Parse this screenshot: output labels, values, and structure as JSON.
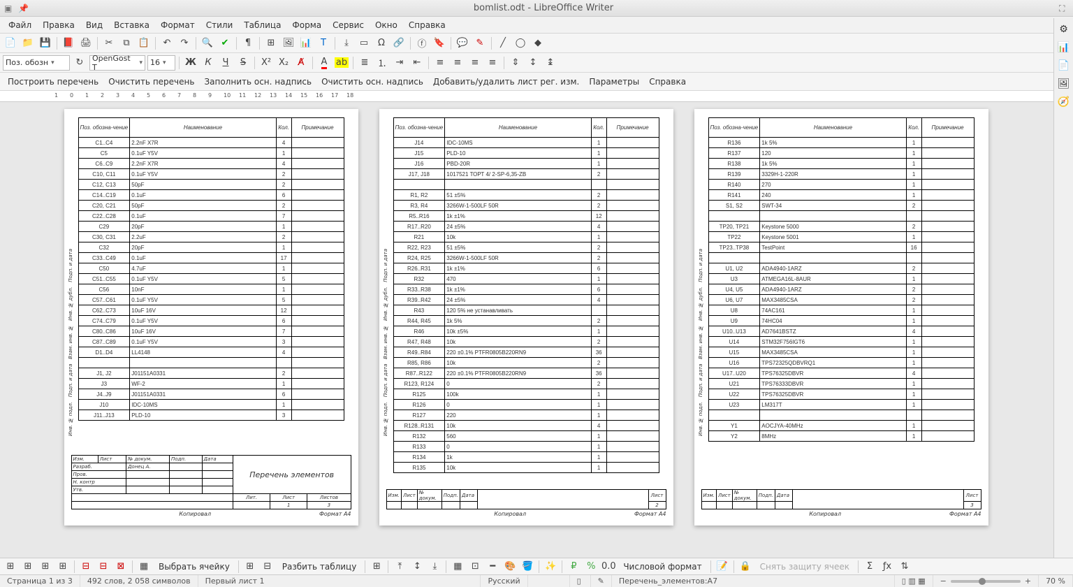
{
  "window": {
    "title": "bomlist.odt - LibreOffice Writer"
  },
  "menu": {
    "items": [
      "Файл",
      "Правка",
      "Вид",
      "Вставка",
      "Формат",
      "Стили",
      "Таблица",
      "Форма",
      "Сервис",
      "Окно",
      "Справка"
    ]
  },
  "toolbar2": {
    "style_combo": "Поз. обозн",
    "font_combo": "OpenGost T",
    "size_combo": "16"
  },
  "toolbar3": {
    "items": [
      "Построить перечень",
      "Очистить перечень",
      "Заполнить осн. надпись",
      "Очистить осн. надпись",
      "Добавить/удалить лист рег. изм.",
      "Параметры",
      "Справка"
    ]
  },
  "toolbar_bottom": {
    "select_cell": "Выбрать ячейку",
    "split_table": "Разбить таблицу",
    "number_format": "Числовой формат",
    "unprotect": "Снять защиту ячеек"
  },
  "status": {
    "page": "Страница 1 из 3",
    "words": "492 слов, 2 058 символов",
    "style": "Первый лист 1",
    "lang": "Русский",
    "object": "Перечень_элементов:A7",
    "zoom": "70 %"
  },
  "doc": {
    "head": {
      "pos": "Поз. обозна-чение",
      "name": "Наименование",
      "qty": "Кол.",
      "note": "Примечание"
    },
    "footer1": {
      "title": "Перечень элементов",
      "copied": "Копировал",
      "format": "Формат  A4",
      "lit": "Лит.",
      "list": "Лист",
      "listov": "Листов",
      "n1": "1",
      "n3": "3",
      "razrab": "Разраб.",
      "author": "Донец  А.",
      "prov": "Пров.",
      "nkontr": "Н. контр",
      "utv": "Утв.",
      "izm": "Изм.",
      "listc": "Лист",
      "ndoc": "№ докум.",
      "podp": "Подп.",
      "data": "Дата"
    },
    "footer23": {
      "sheet_label": "Лист",
      "sheet2": "2",
      "sheet3": "3"
    },
    "sheet1": [
      [
        "C1..C4",
        "2.2nF  X7R",
        "4",
        ""
      ],
      [
        "C5",
        "0.1uF  Y5V",
        "1",
        ""
      ],
      [
        "C6..C9",
        "2.2nF  X7R",
        "4",
        ""
      ],
      [
        "C10, C11",
        "0.1uF  Y5V",
        "2",
        ""
      ],
      [
        "C12, C13",
        "50pF",
        "2",
        ""
      ],
      [
        "C14..C19",
        "0.1uF",
        "6",
        ""
      ],
      [
        "C20, C21",
        "50pF",
        "2",
        ""
      ],
      [
        "C22..C28",
        "0.1uF",
        "7",
        ""
      ],
      [
        "C29",
        "20pF",
        "1",
        ""
      ],
      [
        "C30, C31",
        "2.2uF",
        "2",
        ""
      ],
      [
        "C32",
        "20pF",
        "1",
        ""
      ],
      [
        "C33..C49",
        "0.1uF",
        "17",
        ""
      ],
      [
        "C50",
        "4.7uF",
        "1",
        ""
      ],
      [
        "C51..C55",
        "0.1uF  Y5V",
        "5",
        ""
      ],
      [
        "C56",
        "10nF",
        "1",
        ""
      ],
      [
        "C57..C61",
        "0.1uF  Y5V",
        "5",
        ""
      ],
      [
        "C62..C73",
        "10uF 16V",
        "12",
        ""
      ],
      [
        "C74..C79",
        "0.1uF  Y5V",
        "6",
        ""
      ],
      [
        "C80..C86",
        "10uF 16V",
        "7",
        ""
      ],
      [
        "C87..C89",
        "0.1uF  Y5V",
        "3",
        ""
      ],
      [
        "D1..D4",
        "LL4148",
        "4",
        ""
      ],
      [
        "",
        "",
        "",
        ""
      ],
      [
        "J1, J2",
        "J01151A0331",
        "2",
        ""
      ],
      [
        "J3",
        "WF-2",
        "1",
        ""
      ],
      [
        "J4..J9",
        "J01151A0331",
        "6",
        ""
      ],
      [
        "J10",
        "IDC-10MS",
        "1",
        ""
      ],
      [
        "J11..J13",
        "PLD-10",
        "3",
        ""
      ]
    ],
    "sheet2": [
      [
        "J14",
        "IDC-10MS",
        "1",
        ""
      ],
      [
        "J15",
        "PLD-10",
        "1",
        ""
      ],
      [
        "J16",
        "PBD-20R",
        "1",
        ""
      ],
      [
        "J17, J18",
        "1017521 ТОРТ 4/ 2-SP-6,35-ZB",
        "2",
        ""
      ],
      [
        "",
        "",
        "",
        ""
      ],
      [
        "R1, R2",
        "51 ±5%",
        "2",
        ""
      ],
      [
        "R3, R4",
        "3266W-1-500LF 50R",
        "2",
        ""
      ],
      [
        "R5..R16",
        "1k ±1%",
        "12",
        ""
      ],
      [
        "R17..R20",
        "24 ±5%",
        "4",
        ""
      ],
      [
        "R21",
        "10k",
        "1",
        ""
      ],
      [
        "R22, R23",
        "51 ±5%",
        "2",
        ""
      ],
      [
        "R24, R25",
        "3266W-1-500LF 50R",
        "2",
        ""
      ],
      [
        "R26..R31",
        "1k ±1%",
        "6",
        ""
      ],
      [
        "R32",
        "470",
        "1",
        ""
      ],
      [
        "R33..R38",
        "1k ±1%",
        "6",
        ""
      ],
      [
        "R39..R42",
        "24 ±5%",
        "4",
        ""
      ],
      [
        "R43",
        "120 5% не устанавливать",
        "",
        ""
      ],
      [
        "R44, R45",
        "1k 5%",
        "2",
        ""
      ],
      [
        "R46",
        "10k ±5%",
        "1",
        ""
      ],
      [
        "R47, R48",
        "10k",
        "2",
        ""
      ],
      [
        "R49..R84",
        "220 ±0.1% PTFR0805B220RN9",
        "36",
        ""
      ],
      [
        "R85, R86",
        "10k",
        "2",
        ""
      ],
      [
        "R87..R122",
        "220 ±0.1% PTFR0805B220RN9",
        "36",
        ""
      ],
      [
        "R123, R124",
        "0",
        "2",
        ""
      ],
      [
        "R125",
        "100k",
        "1",
        ""
      ],
      [
        "R126",
        "0",
        "1",
        ""
      ],
      [
        "R127",
        "220",
        "1",
        ""
      ],
      [
        "R128..R131",
        "10k",
        "4",
        ""
      ],
      [
        "R132",
        "560",
        "1",
        ""
      ],
      [
        "R133",
        "0",
        "1",
        ""
      ],
      [
        "R134",
        "1k",
        "1",
        ""
      ],
      [
        "R135",
        "10k",
        "1",
        ""
      ]
    ],
    "sheet3": [
      [
        "R136",
        "1k 5%",
        "1",
        ""
      ],
      [
        "R137",
        "120",
        "1",
        ""
      ],
      [
        "R138",
        "1k 5%",
        "1",
        ""
      ],
      [
        "R139",
        "3329H-1-220R",
        "1",
        ""
      ],
      [
        "R140",
        "270",
        "1",
        ""
      ],
      [
        "R141",
        "240",
        "1",
        ""
      ],
      [
        "S1, S2",
        "SWT-34",
        "2",
        ""
      ],
      [
        "",
        "",
        "",
        ""
      ],
      [
        "TP20, TP21",
        "Keystone 5000",
        "2",
        ""
      ],
      [
        "TP22",
        "Keystone 5001",
        "1",
        ""
      ],
      [
        "TP23..TP38",
        "TestPoint",
        "16",
        ""
      ],
      [
        "",
        "",
        "",
        ""
      ],
      [
        "U1, U2",
        "ADA4940-1ARZ",
        "2",
        ""
      ],
      [
        "U3",
        "ATMEGA16L-8AUR",
        "1",
        ""
      ],
      [
        "U4, U5",
        "ADA4940-1ARZ",
        "2",
        ""
      ],
      [
        "U6, U7",
        "MAX3485CSA",
        "2",
        ""
      ],
      [
        "U8",
        "74AC161",
        "1",
        ""
      ],
      [
        "U9",
        "74HC04",
        "1",
        ""
      ],
      [
        "U10..U13",
        "AD7641BSTZ",
        "4",
        ""
      ],
      [
        "U14",
        "STM32F756IGT6",
        "1",
        ""
      ],
      [
        "U15",
        "MAX3485CSA",
        "1",
        ""
      ],
      [
        "U16",
        "TPS72325QDBVRQ1",
        "1",
        ""
      ],
      [
        "U17..U20",
        "TPS76325DBVR",
        "4",
        ""
      ],
      [
        "U21",
        "TPS76333DBVR",
        "1",
        ""
      ],
      [
        "U22",
        "TPS76325DBVR",
        "1",
        ""
      ],
      [
        "U23",
        "LM317T",
        "1",
        ""
      ],
      [
        "",
        "",
        "",
        ""
      ],
      [
        "Y1",
        "AOCJYA-40MHz",
        "1",
        ""
      ],
      [
        "Y2",
        "8MHz",
        "1",
        ""
      ]
    ]
  }
}
